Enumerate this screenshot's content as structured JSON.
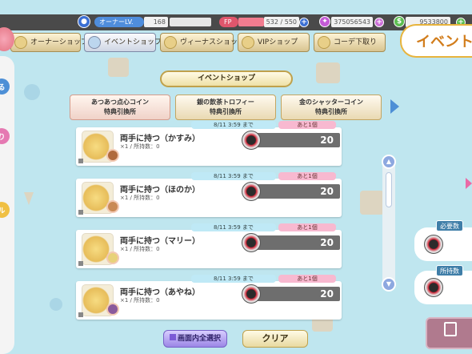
{
  "header": {
    "owner_label": "オーナーLV.",
    "owner_level": "168",
    "fp_label": "FP",
    "fp_value": "532 / 550",
    "gem_value": "375056543",
    "coin_value": "9533800"
  },
  "tabs": [
    {
      "label": "オーナーショップ"
    },
    {
      "label": "イベントショップ"
    },
    {
      "label": "ヴィーナスショップ"
    },
    {
      "label": "VIPショップ"
    },
    {
      "label": "コーデ下取り"
    }
  ],
  "page_title": "イベントショップ",
  "heading": "イベント",
  "exchange": [
    {
      "line1": "あつあつ点心コイン",
      "line2": "特典引換所"
    },
    {
      "line1": "銀の飲茶トロフィー",
      "line2": "特典引換所"
    },
    {
      "line1": "金のシャッターコイン",
      "line2": "特典引換所"
    }
  ],
  "items": [
    {
      "name": "両手に持つ（かすみ）",
      "sub": "×1 / 所持数：0",
      "date": "8/11 3:59 まで",
      "remain": "あと1個",
      "cost": "20"
    },
    {
      "name": "両手に持つ（ほのか）",
      "sub": "×1 / 所持数：0",
      "date": "8/11 3:59 まで",
      "remain": "あと1個",
      "cost": "20"
    },
    {
      "name": "両手に持つ（マリー）",
      "sub": "×1 / 所持数：0",
      "date": "8/11 3:59 まで",
      "remain": "あと1個",
      "cost": "20"
    },
    {
      "name": "両手に持つ（あやね）",
      "sub": "×1 / 所持数：0",
      "date": "8/11 3:59 まで",
      "remain": "あと1個",
      "cost": "20"
    }
  ],
  "buttons": {
    "select_all": "画面内全選択",
    "clear": "クリア"
  },
  "right": {
    "required": "必要数",
    "owned": "所持数"
  },
  "left_tabs": {
    "a": "る",
    "b": "り",
    "c": "ル"
  },
  "colors": {
    "fp_bar": "#f17c8f",
    "tag_date": "#bfe9f6",
    "tag_remain": "#f8b9d0"
  }
}
